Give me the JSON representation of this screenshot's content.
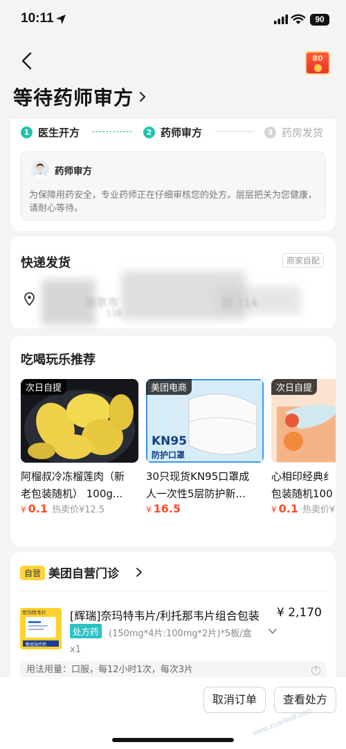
{
  "status_bar": {
    "time": "10:11",
    "battery": "90"
  },
  "header": {
    "title": "等待药师审方",
    "coupon_amount": "80"
  },
  "progress": {
    "steps": [
      {
        "num": "1",
        "label": "医生开方",
        "state": "done"
      },
      {
        "num": "2",
        "label": "药师审方",
        "state": "current"
      },
      {
        "num": "3",
        "label": "药房发货",
        "state": "pending"
      }
    ],
    "pharmacist": {
      "title": "药师审方",
      "description": "为保障用药安全，专业药师正在仔细审核您的处方。层层把关为您健康，请耐心等待。"
    }
  },
  "delivery": {
    "title": "快递发货",
    "tag": "商家自配",
    "address_line1": "南京市",
    "address_suffix": "部（14",
    "address_line2": "138"
  },
  "recommend": {
    "title": "吃喝玩乐推荐",
    "products": [
      {
        "tag": "次日自提",
        "name_line1": "阿榴叔冷冻榴莲肉（新",
        "name_line2": "老包装随机） 100g...",
        "currency": "¥",
        "price": "0.1",
        "hot_price": "热卖价¥12.5",
        "image": "durian"
      },
      {
        "tag": "美团电商",
        "name_line1": "30只现货KN95口罩成",
        "name_line2": "人一次性5层防护新...",
        "currency": "¥",
        "price": "16.5",
        "hot_price": "",
        "image": "kn95-mask",
        "image_text_1": "KN95",
        "image_text_2": "防护口罩"
      },
      {
        "tag": "次日自提",
        "name_line1": "心相印经典纟",
        "name_line2": "包装随机100",
        "currency": "¥",
        "price": "0.1",
        "hot_price": "热卖价¥",
        "image": "tissue-box"
      }
    ]
  },
  "clinic": {
    "badge": "自营",
    "name": "美团自营门诊",
    "medicine": {
      "name": "[辉瑞]奈玛特韦片/利托那韦片组合包装",
      "price": "¥ 2,170",
      "rx_badge": "处方药",
      "spec": "(150mg*4片:100mg*2片)*5板/盒",
      "qty": "x1",
      "image_label_1": "奈玛特韦片",
      "image_label_2": "新冠治疗药"
    },
    "usage": "用法用量：口服，每12小时1次，每次3片"
  },
  "actions": {
    "cancel": "取消订单",
    "view": "查看处方"
  },
  "watermark": "www.zuanke8.com",
  "colors": {
    "accent": "#22c1a9",
    "price_red": "#ff4a26",
    "badge_yellow": "#ffd33b"
  }
}
